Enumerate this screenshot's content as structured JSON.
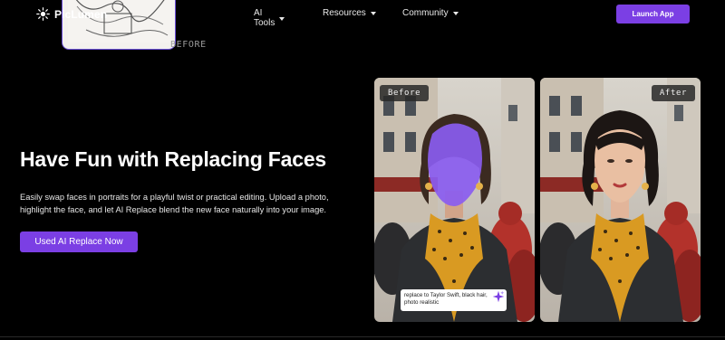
{
  "brand": {
    "name": "PicLumen"
  },
  "nav": {
    "items": [
      {
        "label": "AI Tools"
      },
      {
        "label": "Resources"
      },
      {
        "label": "Community"
      }
    ],
    "launch_label": "Launch App"
  },
  "previous_card": {
    "label": "BEFORE"
  },
  "hero": {
    "title": "Have Fun with Replacing Faces",
    "description": "Easily swap faces in portraits for a playful twist or practical editing. Upload a photo, highlight the face, and let AI Replace blend the new face naturally into your image.",
    "cta_label": "Used AI Replace Now"
  },
  "panels": {
    "before_label": "Before",
    "after_label": "After",
    "prompt_text": "replace to Taylor Swift, black hair, photo realistic"
  },
  "colors": {
    "accent": "#7b3fe4",
    "mask": "#8a5cf0",
    "background": "#000000"
  }
}
